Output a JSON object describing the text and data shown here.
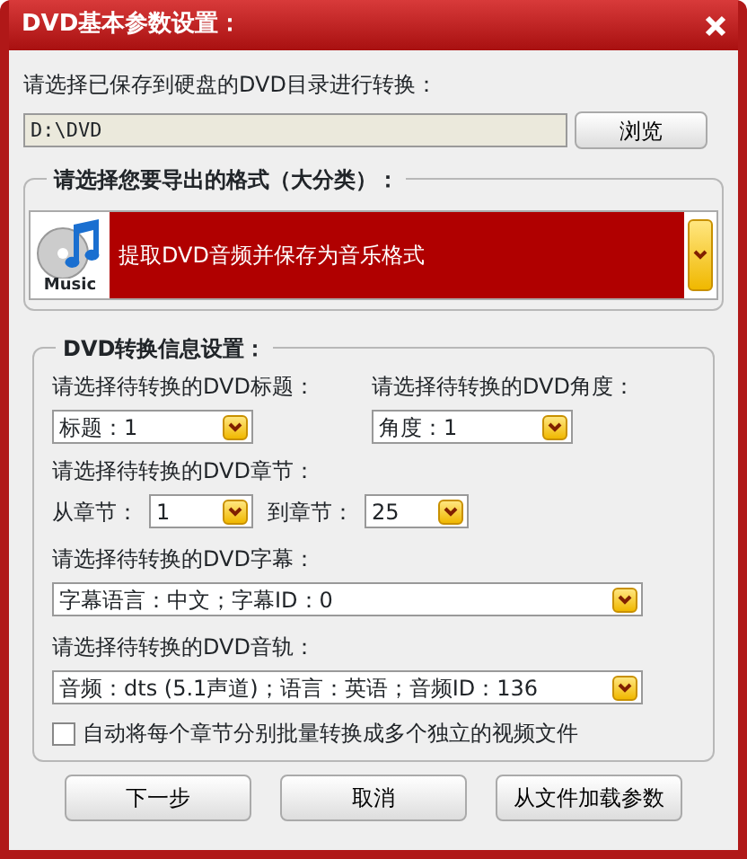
{
  "window": {
    "title": "DVD基本参数设置："
  },
  "source": {
    "label": "请选择已保存到硬盘的DVD目录进行转换：",
    "path": "D:\\DVD",
    "browse_button": "浏览"
  },
  "format_group": {
    "title": "请选择您要导出的格式（大分类）：",
    "selected_format": "提取DVD音频并保存为音乐格式",
    "icon_caption": "Music"
  },
  "info_group": {
    "title": "DVD转换信息设置：",
    "title_select": {
      "label": "请选择待转换的DVD标题：",
      "value": "标题：1"
    },
    "angle_select": {
      "label": "请选择待转换的DVD角度：",
      "value": "角度：1"
    },
    "chapters": {
      "label": "请选择待转换的DVD章节：",
      "from_label": "从章节：",
      "from_value": "1",
      "to_label": "到章节：",
      "to_value": "25"
    },
    "subtitle_select": {
      "label": "请选择待转换的DVD字幕：",
      "value": "字幕语言：中文；字幕ID：0"
    },
    "audio_select": {
      "label": "请选择待转换的DVD音轨：",
      "value": "音频：dts (5.1声道)；语言：英语；音频ID：136"
    },
    "split_chapters": {
      "label": "自动将每个章节分别批量转换成多个独立的视频文件",
      "checked": false
    }
  },
  "buttons": [
    "下一步",
    "取消",
    "从文件加载参数"
  ]
}
